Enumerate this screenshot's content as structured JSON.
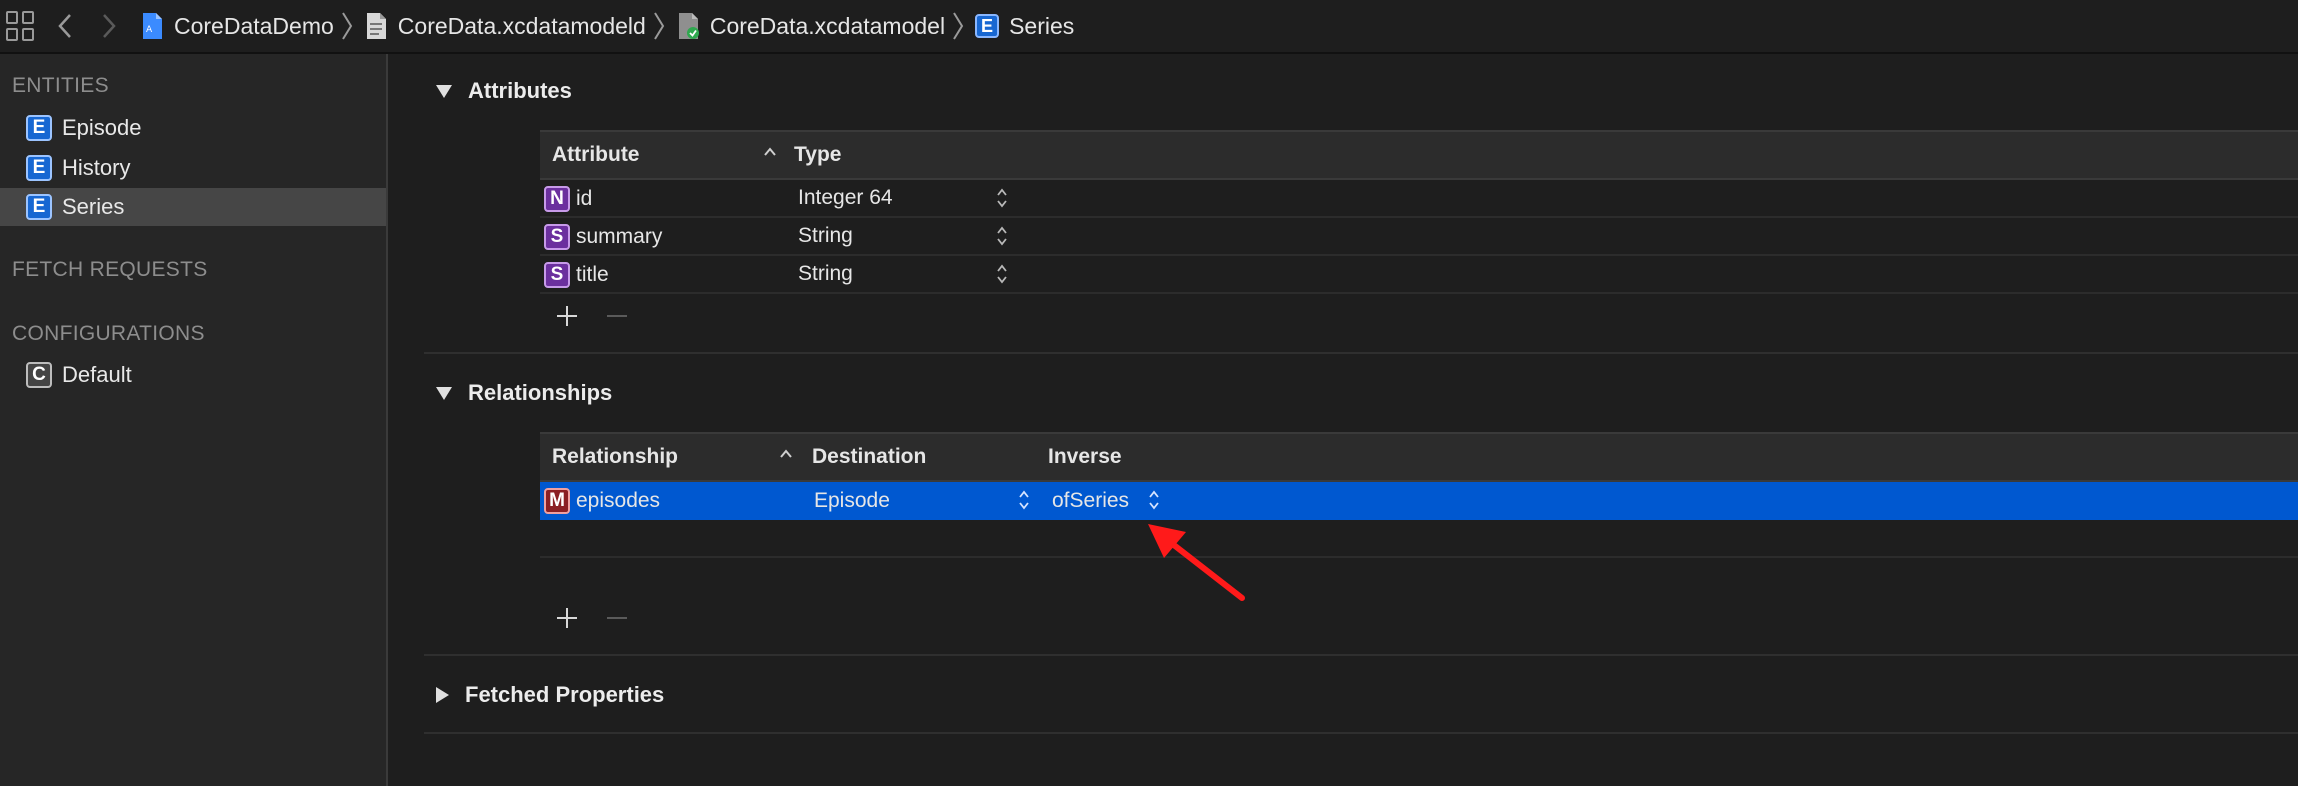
{
  "toolbar": {
    "back_label": "Back",
    "forward_label": "Forward"
  },
  "breadcrumbs": [
    {
      "label": "CoreDataDemo",
      "icon": "project-icon"
    },
    {
      "label": "CoreData.xcdatamodeld",
      "icon": "model-bundle-icon"
    },
    {
      "label": "CoreData.xcdatamodel",
      "icon": "model-file-icon"
    },
    {
      "label": "Series",
      "icon": "entity-icon",
      "badge": "E"
    }
  ],
  "sidebar": {
    "entities_header": "ENTITIES",
    "entities": [
      {
        "badge": "E",
        "label": "Episode"
      },
      {
        "badge": "E",
        "label": "History"
      },
      {
        "badge": "E",
        "label": "Series",
        "selected": true
      }
    ],
    "fetch_requests_header": "FETCH REQUESTS",
    "configurations_header": "CONFIGURATIONS",
    "configurations": [
      {
        "badge": "C",
        "label": "Default"
      }
    ]
  },
  "attributes": {
    "title": "Attributes",
    "col_attribute": "Attribute",
    "col_type": "Type",
    "rows": [
      {
        "badge": "N",
        "name": "id",
        "type": "Integer 64"
      },
      {
        "badge": "S",
        "name": "summary",
        "type": "String"
      },
      {
        "badge": "S",
        "name": "title",
        "type": "String"
      }
    ]
  },
  "relationships": {
    "title": "Relationships",
    "col_relationship": "Relationship",
    "col_destination": "Destination",
    "col_inverse": "Inverse",
    "rows": [
      {
        "badge": "M",
        "name": "episodes",
        "destination": "Episode",
        "inverse": "ofSeries"
      }
    ]
  },
  "fetched_properties": {
    "title": "Fetched Properties"
  },
  "colors": {
    "selection": "#0058d0",
    "entity_badge": "#1767d2",
    "property_badge": "#6b2f9e",
    "relationship_badge": "#8b1f24",
    "annotation_arrow": "#ff1a1a"
  }
}
